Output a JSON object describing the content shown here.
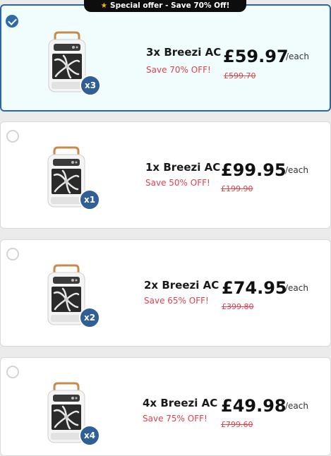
{
  "banner": {
    "star_icon": "star-icon",
    "text": "Special offer - Save 70% Off!"
  },
  "offers": [
    {
      "selected": true,
      "badge": "x3",
      "name": "3x Breezi AC",
      "discount": "Save 70% OFF!",
      "price": "£59.97",
      "per": "/each",
      "original": "£599.70"
    },
    {
      "selected": false,
      "badge": "x1",
      "name": "1x Breezi AC",
      "discount": "Save 50% OFF!",
      "price": "£99.95",
      "per": "/each",
      "original": "£199.90"
    },
    {
      "selected": false,
      "badge": "x2",
      "name": "2x Breezi AC",
      "discount": "Save 65% OFF!",
      "price": "£74.95",
      "per": "/each",
      "original": "£399.80"
    },
    {
      "selected": false,
      "badge": "x4",
      "name": "4x Breezi AC",
      "discount": "Save 75% OFF!",
      "price": "£49.98",
      "per": "/each",
      "original": "£799.60"
    }
  ],
  "colors": {
    "accent": "#2f6aa8",
    "discount": "#e0414e",
    "selected_bg": "#f0fdfc",
    "badge": "#2f5f95"
  }
}
